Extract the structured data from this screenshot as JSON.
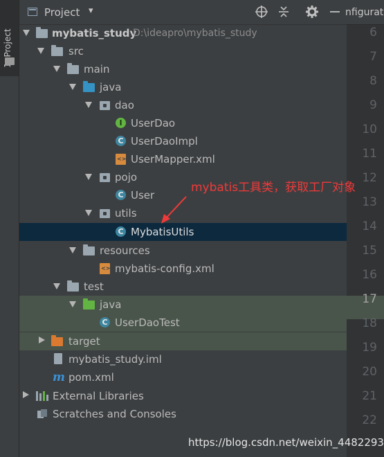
{
  "tool_strip": {
    "label": "1: Project"
  },
  "header": {
    "title": "Project",
    "dropdown_glyph": "▾",
    "icons": [
      "crosshair-icon",
      "collapse-icon",
      "gear-icon",
      "minimize-icon"
    ]
  },
  "tree": {
    "root": {
      "name": "mybatis_study",
      "path": "D:\\ideapro\\mybatis_study"
    },
    "src": "src",
    "main": "main",
    "java": "java",
    "dao": "dao",
    "dao_interface": "UserDao",
    "dao_impl": "UserDaoImpl",
    "dao_mapper": "UserMapper.xml",
    "pojo": "pojo",
    "pojo_user": "User",
    "utils": "utils",
    "utils_class": "MybatisUtils",
    "resources": "resources",
    "config_xml": "mybatis-config.xml",
    "test": "test",
    "test_java": "java",
    "test_class": "UserDaoTest",
    "target": "target",
    "iml": "mybatis_study.iml",
    "pom": "pom.xml",
    "external_libraries": "External Libraries",
    "scratches": "Scratches and Consoles"
  },
  "editor": {
    "tab_label": "nfigurat",
    "line_numbers": [
      "6",
      "7",
      "8",
      "9",
      "10",
      "11",
      "12",
      "13",
      "14",
      "15",
      "16",
      "17",
      "18",
      "19",
      "20",
      "21",
      "22"
    ],
    "active_line": "17"
  },
  "annotation": {
    "text": "mybatis工具类，获取工厂对象",
    "color": "#f03a3a"
  },
  "watermark": "https://blog.csdn.net/weixin_44822939"
}
